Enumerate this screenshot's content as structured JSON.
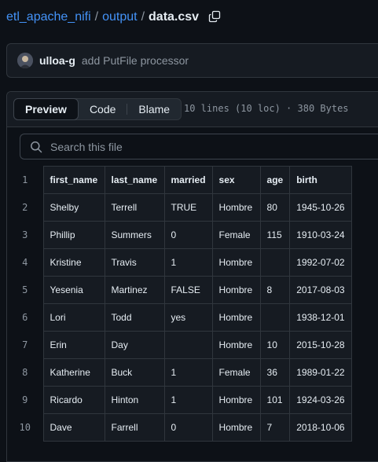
{
  "breadcrumb": {
    "repo": "etl_apache_nifi",
    "folder": "output",
    "file": "data.csv",
    "separator": "/"
  },
  "commit": {
    "author": "ulloa-g",
    "message": "add PutFile processor"
  },
  "view_toggle": {
    "preview": "Preview",
    "code": "Code",
    "blame": "Blame",
    "selected": "Preview"
  },
  "file_meta": "10 lines (10 loc) · 380 Bytes",
  "search": {
    "placeholder": "Search this file",
    "value": ""
  },
  "icons": {
    "copy": "copy-icon",
    "search": "search-icon",
    "avatar": "avatar"
  },
  "colors": {
    "link": "#4493f8",
    "background": "#0d1117",
    "panel": "#161b22",
    "border": "#30363d",
    "muted": "#8d96a0"
  },
  "table": {
    "header_line_number": "1",
    "columns": [
      "first_name",
      "last_name",
      "married",
      "sex",
      "age",
      "birth"
    ],
    "rows": [
      {
        "line": "2",
        "cells": [
          "Shelby",
          "Terrell",
          "TRUE",
          "Hombre",
          "80",
          "1945-10-26"
        ]
      },
      {
        "line": "3",
        "cells": [
          "Phillip",
          "Summers",
          "0",
          "Female",
          "115",
          "1910-03-24"
        ]
      },
      {
        "line": "4",
        "cells": [
          "Kristine",
          "Travis",
          "1",
          "Hombre",
          "",
          "1992-07-02"
        ]
      },
      {
        "line": "5",
        "cells": [
          "Yesenia",
          "Martinez",
          "FALSE",
          "Hombre",
          "8",
          "2017-08-03"
        ]
      },
      {
        "line": "6",
        "cells": [
          "Lori",
          "Todd",
          "yes",
          "Hombre",
          "",
          "1938-12-01"
        ]
      },
      {
        "line": "7",
        "cells": [
          "Erin",
          "Day",
          "",
          "Hombre",
          "10",
          "2015-10-28"
        ]
      },
      {
        "line": "8",
        "cells": [
          "Katherine",
          "Buck",
          "1",
          "Female",
          "36",
          "1989-01-22"
        ]
      },
      {
        "line": "9",
        "cells": [
          "Ricardo",
          "Hinton",
          "1",
          "Hombre",
          "101",
          "1924-03-26"
        ]
      },
      {
        "line": "10",
        "cells": [
          "Dave",
          "Farrell",
          "0",
          "Hombre",
          "7",
          "2018-10-06"
        ]
      }
    ]
  }
}
